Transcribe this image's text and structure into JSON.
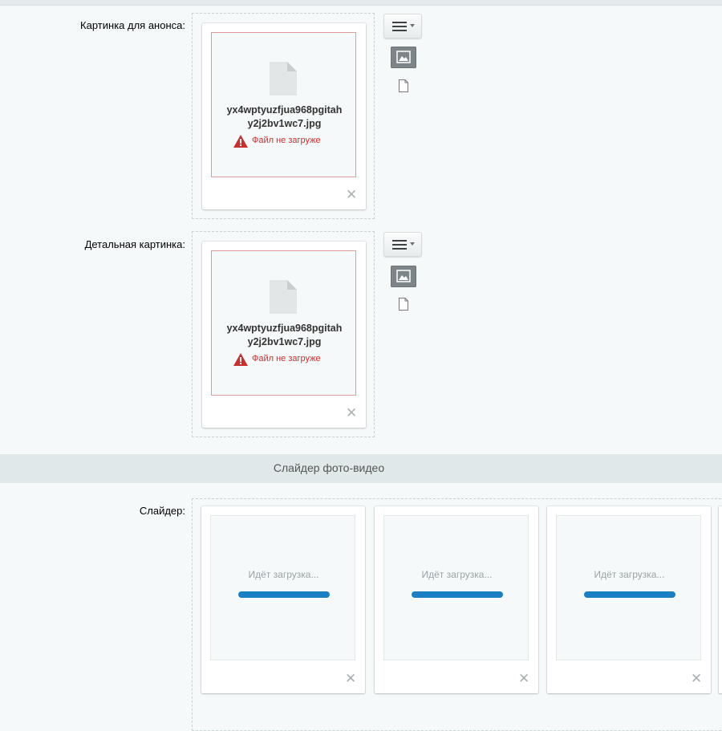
{
  "fields": {
    "announce": {
      "label": "Картинка для анонса:",
      "file": {
        "name_line1": "yx4wptyuzfjua968pgitah",
        "name_line2": "y2j2bv1wc7.jpg",
        "error": "Файл не загруже"
      }
    },
    "detail": {
      "label": "Детальная картинка:",
      "file": {
        "name_line1": "yx4wptyuzfjua968pgitah",
        "name_line2": "y2j2bv1wc7.jpg",
        "error": "Файл не загруже"
      }
    },
    "slider": {
      "label": "Слайдер:",
      "items": [
        {
          "loading_text": "Идёт загрузка..."
        },
        {
          "loading_text": "Идёт загрузка..."
        },
        {
          "loading_text": "Идёт загрузка..."
        }
      ]
    }
  },
  "section": {
    "title": "Слайдер фото-видео"
  },
  "icons": {
    "menu": "hamburger-menu-icon",
    "image_mode": "image-icon",
    "file_mode": "document-icon",
    "close": "close-icon",
    "file": "file-icon",
    "warning": "warning-icon"
  },
  "colors": {
    "error": "#d22c2c",
    "progress": "#1a7fc3",
    "section_bg": "#e0e8e9"
  }
}
